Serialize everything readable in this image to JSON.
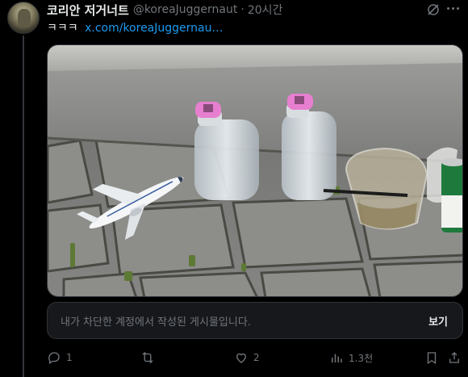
{
  "tweet": {
    "author_name": "코리안 저거너트",
    "handle": "@koreaJuggernaut",
    "separator": "·",
    "time": "20시간",
    "text": "ㅋㅋㅋ",
    "link": "x.com/koreaJuggernau…"
  },
  "blocked_notice": {
    "text": "내가 차단한 계정에서 작성된 게시물입니다.",
    "button": "보기"
  },
  "actions": {
    "reply_count": "1",
    "like_count": "2",
    "views_count": "1.3천"
  },
  "icons": {
    "header": [
      "grok-icon",
      "more-icon"
    ],
    "actions": [
      "reply-icon",
      "retweet-icon",
      "like-icon",
      "views-icon",
      "bookmark-icon",
      "share-icon"
    ]
  },
  "colors": {
    "background": "#000000",
    "text": "#e7e9ea",
    "muted": "#71767b",
    "link": "#1d9bf0",
    "card": "#16181c",
    "border": "#2f3336"
  }
}
